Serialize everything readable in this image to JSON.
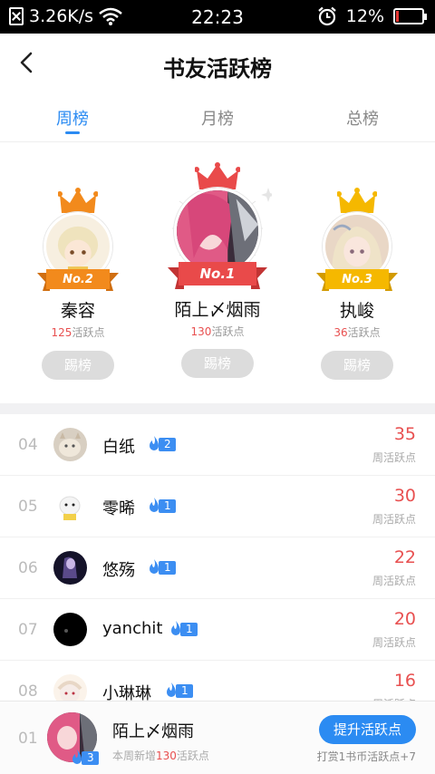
{
  "status_bar": {
    "speed": "3.26K/s",
    "time": "22:23",
    "battery": "12%",
    "battery_level": 0.12,
    "icons": [
      "sim-off-icon",
      "wifi-icon",
      "alarm-icon",
      "battery-icon"
    ]
  },
  "header": {
    "title": "书友活跃榜",
    "back_icon": "chevron-left-icon"
  },
  "tabs": [
    {
      "label": "周榜",
      "active": true
    },
    {
      "label": "月榜",
      "active": false
    },
    {
      "label": "总榜",
      "active": false
    }
  ],
  "podium": {
    "first": {
      "rank_label": "No.1",
      "name": "陌上〆烟雨",
      "points": "130",
      "points_suffix": "活跃点",
      "button": "踢榜",
      "color": "#e94a4a"
    },
    "second": {
      "rank_label": "No.2",
      "name": "秦容",
      "points": "125",
      "points_suffix": "活跃点",
      "button": "踢榜",
      "color": "#f28a1c"
    },
    "third": {
      "rank_label": "No.3",
      "name": "执峻",
      "points": "36",
      "points_suffix": "活跃点",
      "button": "踢榜",
      "color": "#f5b800"
    }
  },
  "list": [
    {
      "rank": "04",
      "name": "白纸",
      "level": "2",
      "score": "35",
      "score_label": "周活跃点"
    },
    {
      "rank": "05",
      "name": "零晞",
      "level": "1",
      "score": "30",
      "score_label": "周活跃点"
    },
    {
      "rank": "06",
      "name": "悠殇",
      "level": "1",
      "score": "22",
      "score_label": "周活跃点"
    },
    {
      "rank": "07",
      "name": "yanchit",
      "level": "1",
      "score": "20",
      "score_label": "周活跃点"
    },
    {
      "rank": "08",
      "name": "小琳琳",
      "level": "1",
      "score": "16",
      "score_label": "周活跃点"
    }
  ],
  "bottom": {
    "rank": "01",
    "name": "陌上〆烟雨",
    "level": "3",
    "sub_prefix": "本周新增",
    "sub_num": "130",
    "sub_suffix": "活跃点",
    "button": "提升活跃点",
    "tip": "打赏1书币活跃点+7"
  },
  "colors": {
    "accent": "#2b8bf2",
    "score": "#e85050"
  }
}
